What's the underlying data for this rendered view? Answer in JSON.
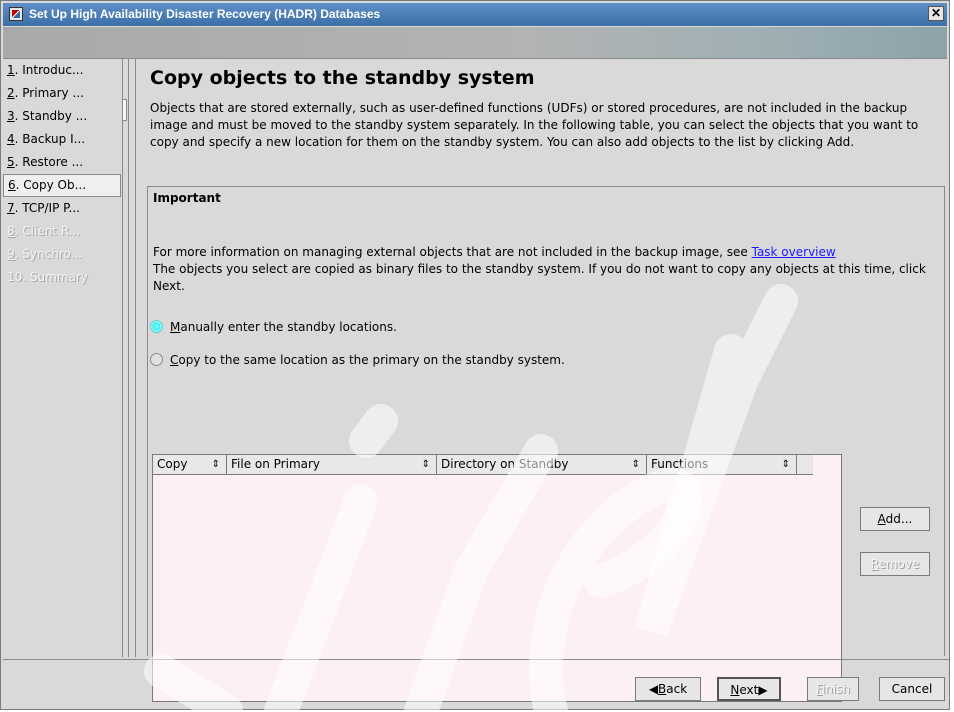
{
  "window": {
    "title": "Set Up High Availability Disaster Recovery (HADR) Databases",
    "close_label": "✕"
  },
  "steps": [
    {
      "num": "1",
      "label": ". Introduc...",
      "state": "normal"
    },
    {
      "num": "2",
      "label": ". Primary ...",
      "state": "normal"
    },
    {
      "num": "3",
      "label": ". Standby ...",
      "state": "normal"
    },
    {
      "num": "4",
      "label": ". Backup I...",
      "state": "normal"
    },
    {
      "num": "5",
      "label": ". Restore ...",
      "state": "normal"
    },
    {
      "num": "6",
      "label": ". Copy Ob...",
      "state": "current"
    },
    {
      "num": "7",
      "label": ". TCP/IP P...",
      "state": "normal"
    },
    {
      "num": "8",
      "label": ". Client R...",
      "state": "disabled"
    },
    {
      "num": "9",
      "label": ". Synchro...",
      "state": "disabled"
    },
    {
      "num": "",
      "label": "10. Summary",
      "state": "disabled"
    }
  ],
  "page": {
    "title": "Copy objects to the standby system",
    "description": "Objects that are stored externally, such as user-defined functions (UDFs) or stored procedures, are not included in the backup image and must be moved to the standby system separately. In the following table, you can select the objects that you want to copy and specify a new location for them on the standby system. You can also add objects to the list by clicking Add."
  },
  "important": {
    "title": "Important",
    "text_before_link": "For more information on managing external objects that are not included in the backup image, see ",
    "link": "Task overview",
    "text_after_link": "The objects you select are copied as binary files to the standby system. If you do not want to copy any objects at this time, click Next."
  },
  "radios": [
    {
      "mnemonic": "M",
      "rest": "anually enter the standby locations.",
      "selected": true
    },
    {
      "mnemonic": "C",
      "rest": "opy to the same location as the primary on the standby system.",
      "selected": false
    }
  ],
  "table": {
    "columns": [
      "Copy",
      "File on Primary",
      "Directory on Standby",
      "Functions"
    ],
    "sort_icon": "⇕",
    "rows": []
  },
  "side_buttons": {
    "add": {
      "mnemonic": "A",
      "rest": "dd..."
    },
    "remove": {
      "mnemonic": "R",
      "rest": "emove"
    }
  },
  "footer": {
    "back": {
      "mnemonic": "B",
      "rest": "ack"
    },
    "next": {
      "mnemonic": "N",
      "rest": "ext"
    },
    "finish": {
      "mnemonic": "F",
      "rest": "inish"
    },
    "cancel": "Cancel"
  },
  "colors": {
    "titlebar": "#4a7db8",
    "link": "#1a1aff",
    "table_background": "#fcf0f5",
    "radio_selected": "#4ee"
  }
}
